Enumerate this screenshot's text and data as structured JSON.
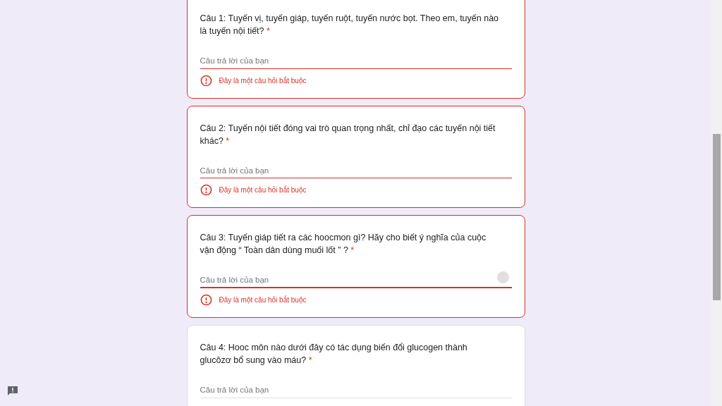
{
  "questions": [
    {
      "title": "Câu 1: Tuyến vị, tuyến giáp, tuyến ruột, tuyến nước bọt. Theo em, tuyến nào là tuyến nội tiết?",
      "required_mark": "*",
      "placeholder": "Câu trả lời của bạn",
      "focused": false,
      "error": "Đây là một câu hỏi bắt buộc"
    },
    {
      "title": "Câu 2: Tuyến nội tiết đóng vai trò quan trọng nhất, chỉ đạo các tuyến nội tiết khác?",
      "required_mark": "*",
      "placeholder": "Câu trả lời của bạn",
      "focused": false,
      "error": "Đây là một câu hỏi bắt buộc"
    },
    {
      "title": "Câu 3: Tuyến giáp tiết ra các hoocmon gì? Hãy cho biết ý nghĩa của cuộc vận động “ Toàn dân dùng muối lốt ” ?",
      "required_mark": "*",
      "placeholder": "Câu trả lời của bạn",
      "focused": true,
      "error": "Đây là một câu hỏi bắt buộc"
    },
    {
      "title": "Câu 4: Hooc môn nào dưới đây có tác dụng biến đổi glucogen thành glucôzơ bổ sung vào máu?",
      "required_mark": "*",
      "placeholder": "Câu trả lời của bạn",
      "focused": false
    }
  ]
}
